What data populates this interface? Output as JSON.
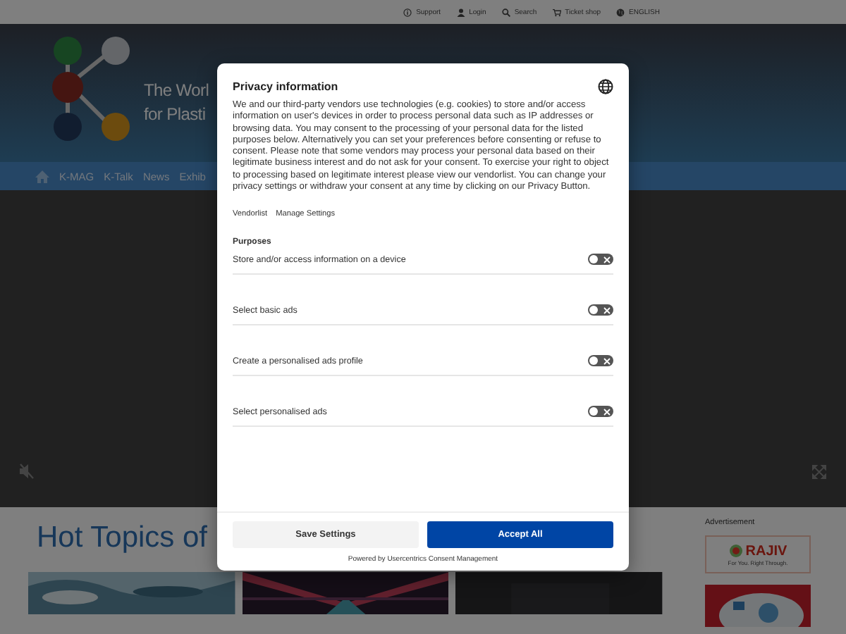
{
  "top_bar": {
    "items": [
      {
        "label": "Support"
      },
      {
        "label": "Login"
      },
      {
        "label": "Search"
      },
      {
        "label": "Ticket shop"
      },
      {
        "label": "ENGLISH"
      }
    ]
  },
  "header": {
    "tagline_lines": [
      "The Worl",
      "for Plasti"
    ]
  },
  "nav": {
    "items": [
      "K-MAG",
      "K-Talk",
      "News",
      "Exhib"
    ]
  },
  "video": {
    "muted": true
  },
  "content": {
    "heading": "Hot Topics of"
  },
  "sidebar": {
    "label": "Advertisement",
    "ad": {
      "brand": "RAJIV",
      "slogan": "For You. Right Through."
    }
  },
  "consent": {
    "title": "Privacy information",
    "body": "We and our third-party vendors use technologies (e.g. cookies) to store and/or access information on user's devices in order to process personal data such as IP addresses or browsing data. You may consent to the processing of your personal data for the listed purposes below. Alternatively you can set your preferences before consenting or refuse to consent. Please note that some vendors may process your personal data based on their legitimate business interest and do not ask for your consent. To exercise your right to object to processing based on legitimate interest please view our vendorlist. You can change your privacy settings or withdraw your consent at any time by clicking on our Privacy Button.",
    "links": [
      "Vendorlist",
      "Manage Settings"
    ],
    "purposes_heading": "Purposes",
    "purposes": [
      {
        "label": "Store and/or access information on a device",
        "checked": false
      },
      {
        "label": "Select basic ads",
        "checked": false
      },
      {
        "label": "Create a personalised ads profile",
        "checked": false
      },
      {
        "label": "Select personalised ads",
        "checked": false
      }
    ],
    "buttons": [
      {
        "label": "Save Settings",
        "kind": "secondary"
      },
      {
        "label": "Accept All",
        "kind": "primary"
      }
    ],
    "footer": "Powered by Usercentrics Consent Management"
  }
}
